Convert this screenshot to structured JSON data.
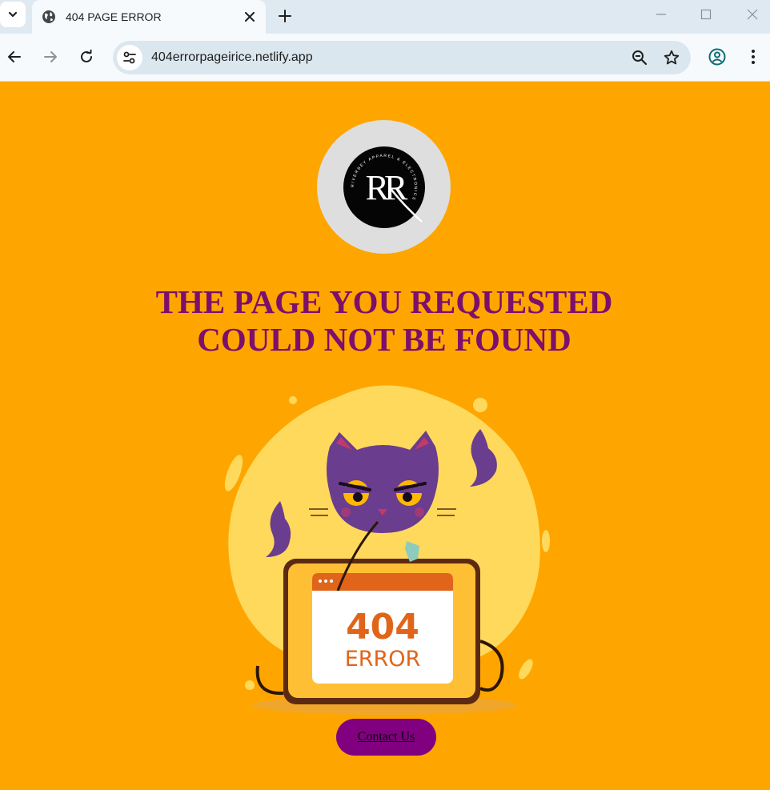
{
  "browser": {
    "tab_title": "404 PAGE ERROR",
    "url": "404errorpageirice.netlify.app"
  },
  "page": {
    "logo": {
      "monogram": "RR",
      "ring_text": "RIVERBEY APPAREL & ELECTRONICS"
    },
    "headline_line1": "THE PAGE YOU REQUESTED",
    "headline_line2": "COULD NOT BE FOUND",
    "illustration": {
      "code": "404",
      "label": "ERROR"
    },
    "contact_button_label": "Contact Us"
  },
  "colors": {
    "page_background": "#ffa500",
    "headline": "#7d0f6c",
    "button_background": "#800080",
    "cat": "#6a3d8e",
    "laptop_frame": "#ffbf35",
    "error_text": "#e0651a"
  },
  "icons": {
    "tab_search": "chevron-down-icon",
    "favicon": "globe-icon",
    "tab_close": "close-icon",
    "new_tab": "plus-icon",
    "back": "arrow-left-icon",
    "forward": "arrow-right-icon",
    "reload": "reload-icon",
    "site_info": "tune-icon",
    "zoom": "zoom-out-icon",
    "bookmark": "star-icon",
    "profile": "account-icon",
    "menu": "kebab-menu-icon"
  }
}
